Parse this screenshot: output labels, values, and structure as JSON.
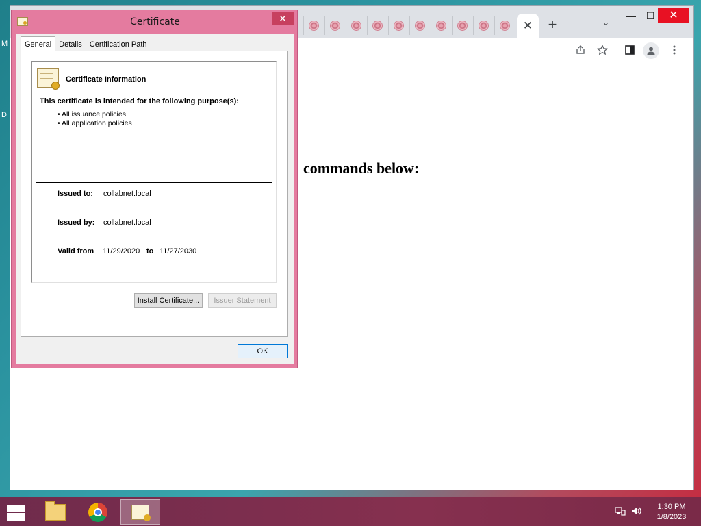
{
  "desktop": {
    "edge_letters": [
      "M",
      "D"
    ]
  },
  "browser": {
    "tab_count_icons": 10,
    "active_tab_close": "✕",
    "new_tab": "+",
    "tab_search": "⌄",
    "window_controls": {
      "minimize": "—",
      "maximize": "☐",
      "close": "✕"
    },
    "toolbar_icons": [
      "share-icon",
      "star-icon",
      "side-panel-icon",
      "profile-icon",
      "menu-icon"
    ],
    "page_heading": "commands below:"
  },
  "dialog": {
    "title": "Certificate",
    "close": "✕",
    "tabs": [
      "General",
      "Details",
      "Certification Path"
    ],
    "active_tab": "General",
    "info_title": "Certificate Information",
    "purpose_heading": "This certificate is intended for the following purpose(s):",
    "purposes": [
      "All issuance policies",
      "All application policies"
    ],
    "issued_to_label": "Issued to:",
    "issued_to": "collabnet.local",
    "issued_by_label": "Issued by:",
    "issued_by": "collabnet.local",
    "valid_from_label": "Valid from",
    "valid_from": "11/29/2020",
    "valid_to_label": "to",
    "valid_to": "11/27/2030",
    "install_button": "Install Certificate...",
    "issuer_button": "Issuer Statement",
    "ok_button": "OK"
  },
  "taskbar": {
    "apps": [
      "file-explorer",
      "chrome",
      "certificate"
    ],
    "active_app": "certificate",
    "time": "1:30 PM",
    "date": "1/8/2023"
  },
  "colors": {
    "dialog_frame": "#e47b9f",
    "taskbar": "#86304f",
    "close_red": "#e81123"
  }
}
